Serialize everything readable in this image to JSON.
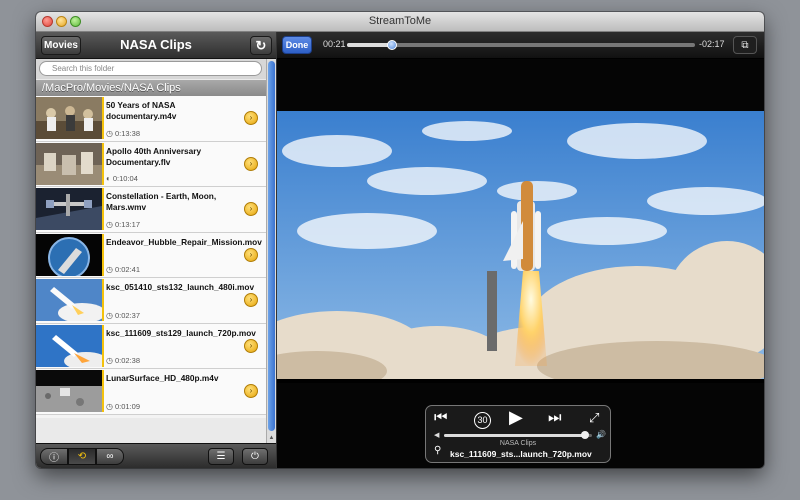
{
  "window": {
    "title": "StreamToMe"
  },
  "left": {
    "back_label": "Movies",
    "folder_title": "NASA Clips",
    "refresh_icon": "refresh-icon",
    "search_placeholder": "Search this folder",
    "path": "/MacPro/Movies/NASA Clips",
    "files": [
      {
        "name": "50 Years of NASA documentary.m4v",
        "duration": "0:13:38"
      },
      {
        "name": "Apollo 40th Anniversary Documentary.flv",
        "duration": "0:10:04"
      },
      {
        "name": "Constellation - Earth, Moon, Mars.wmv",
        "duration": "0:13:17"
      },
      {
        "name": "Endeavor_Hubble_Repair_Mission.mov",
        "duration": "0:02:41"
      },
      {
        "name": "ksc_051410_sts132_launch_480i.mov",
        "duration": "0:02:37"
      },
      {
        "name": "ksc_111609_sts129_launch_720p.mov",
        "duration": "0:02:38"
      },
      {
        "name": "LunarSurface_HD_480p.m4v",
        "duration": "0:01:09"
      }
    ]
  },
  "player": {
    "done_label": "Done",
    "elapsed": "00:21",
    "remaining": "-02:17",
    "progress": 0.13,
    "volume": 0.95,
    "hud_folder": "NASA Clips",
    "hud_file": "ksc_111609_sts...launch_720p.mov",
    "skip_label": "30"
  },
  "colors": {
    "accent": "#f4c20d",
    "done_button": "#3d6fd6"
  }
}
